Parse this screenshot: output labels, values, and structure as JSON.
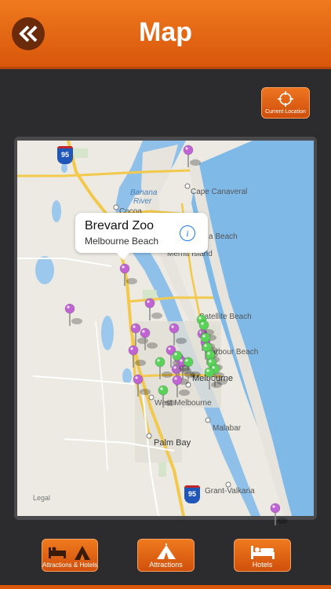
{
  "header": {
    "title": "Map",
    "back_icon": "double-chevron-left-icon"
  },
  "current_location": {
    "label": "Current Location",
    "icon": "crosshair-icon"
  },
  "map": {
    "callout": {
      "title": "Brevard Zoo",
      "subtitle": "Melbourne Beach",
      "info_icon": "info-icon"
    },
    "legal": "Legal",
    "places": {
      "banana_river_1": "Banana",
      "banana_river_2": "River",
      "cocoa": "Cocoa",
      "cape_canaveral": "Cape Canaveral",
      "merritt_island": "Merritt Island",
      "beach_partial": "a Beach",
      "satellite_beach": "Satellite Beach",
      "harbour_beach_partial": "Harbour Beach",
      "melbourne": "Melbourne",
      "west_melbourne": "West Melbourne",
      "malabar": "Malabar",
      "palm_bay": "Palm Bay",
      "grant_valkaria": "Grant-Valkaria",
      "highway_95_top": "95",
      "highway_95_bottom": "95"
    },
    "pin_colors": {
      "attraction": "#c064d4",
      "hotel": "#5bd35b"
    }
  },
  "bottom_bar": {
    "attractions_hotels": "Attractions & Hotels",
    "attractions": "Attractions",
    "hotels": "Hotels"
  }
}
